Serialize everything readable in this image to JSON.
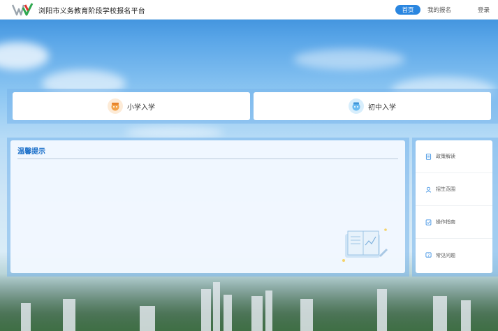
{
  "header": {
    "site_title": "浏阳市义务教育阶段学校报名平台",
    "nav": {
      "home": "首页",
      "my_registration": "我的报名",
      "login": "登录"
    }
  },
  "entries": {
    "primary": "小学入学",
    "middle": "初中入学"
  },
  "notice": {
    "title": "温馨提示"
  },
  "side_menu": {
    "items": [
      {
        "label": "政策解读",
        "icon": "document-icon"
      },
      {
        "label": "招生范围",
        "icon": "user-location-icon"
      },
      {
        "label": "操作指南",
        "icon": "guide-icon"
      },
      {
        "label": "常见问题",
        "icon": "question-icon"
      }
    ]
  },
  "colors": {
    "accent": "#2a86e0",
    "notice_title": "#1a6fc9"
  }
}
